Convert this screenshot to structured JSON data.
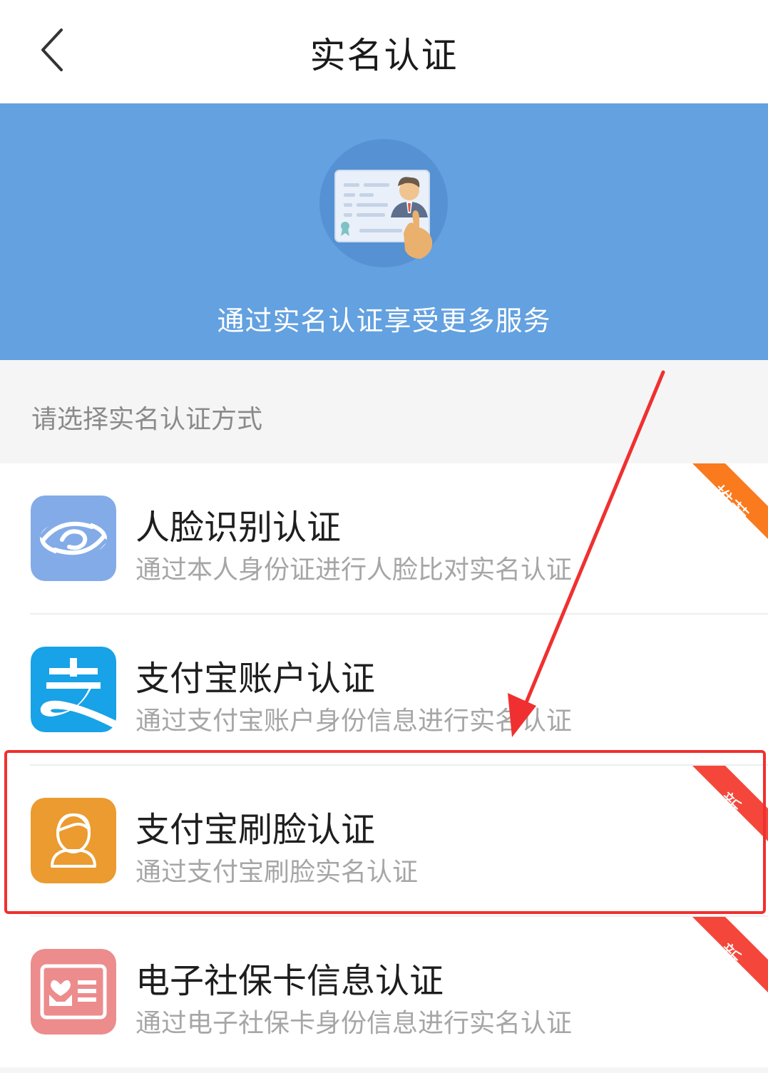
{
  "header": {
    "title": "实名认证",
    "back_icon": "chevron-left-icon"
  },
  "banner": {
    "text": "通过实名认证享受更多服务",
    "background": "#63a1e0",
    "illustration_icon": "id-card-icon"
  },
  "section": {
    "label": "请选择实名认证方式"
  },
  "methods": [
    {
      "title": "人脸识别认证",
      "description": "通过本人身份证进行人脸比对实名认证",
      "icon": "face-recognition-icon",
      "icon_color": "#83abe8",
      "badge": "推荐",
      "badge_color": "#fa7a1e"
    },
    {
      "title": "支付宝账户认证",
      "description": "通过支付宝账户身份信息进行实名认证",
      "icon": "alipay-icon",
      "icon_color": "#18a2e7"
    },
    {
      "title": "支付宝刷脸认证",
      "description": "通过支付宝刷脸实名认证",
      "icon": "alipay-face-icon",
      "icon_color": "#eb9b2f",
      "badge": "新",
      "badge_color": "#f4463a"
    },
    {
      "title": "电子社保卡信息认证",
      "description": "通过电子社保卡身份信息进行实名认证",
      "icon": "social-security-card-icon",
      "icon_color": "#ec8c8c",
      "badge": "新",
      "badge_color": "#f4463a"
    }
  ],
  "annotation": {
    "color": "#f03030",
    "highlighted_item": "支付宝刷脸认证"
  }
}
